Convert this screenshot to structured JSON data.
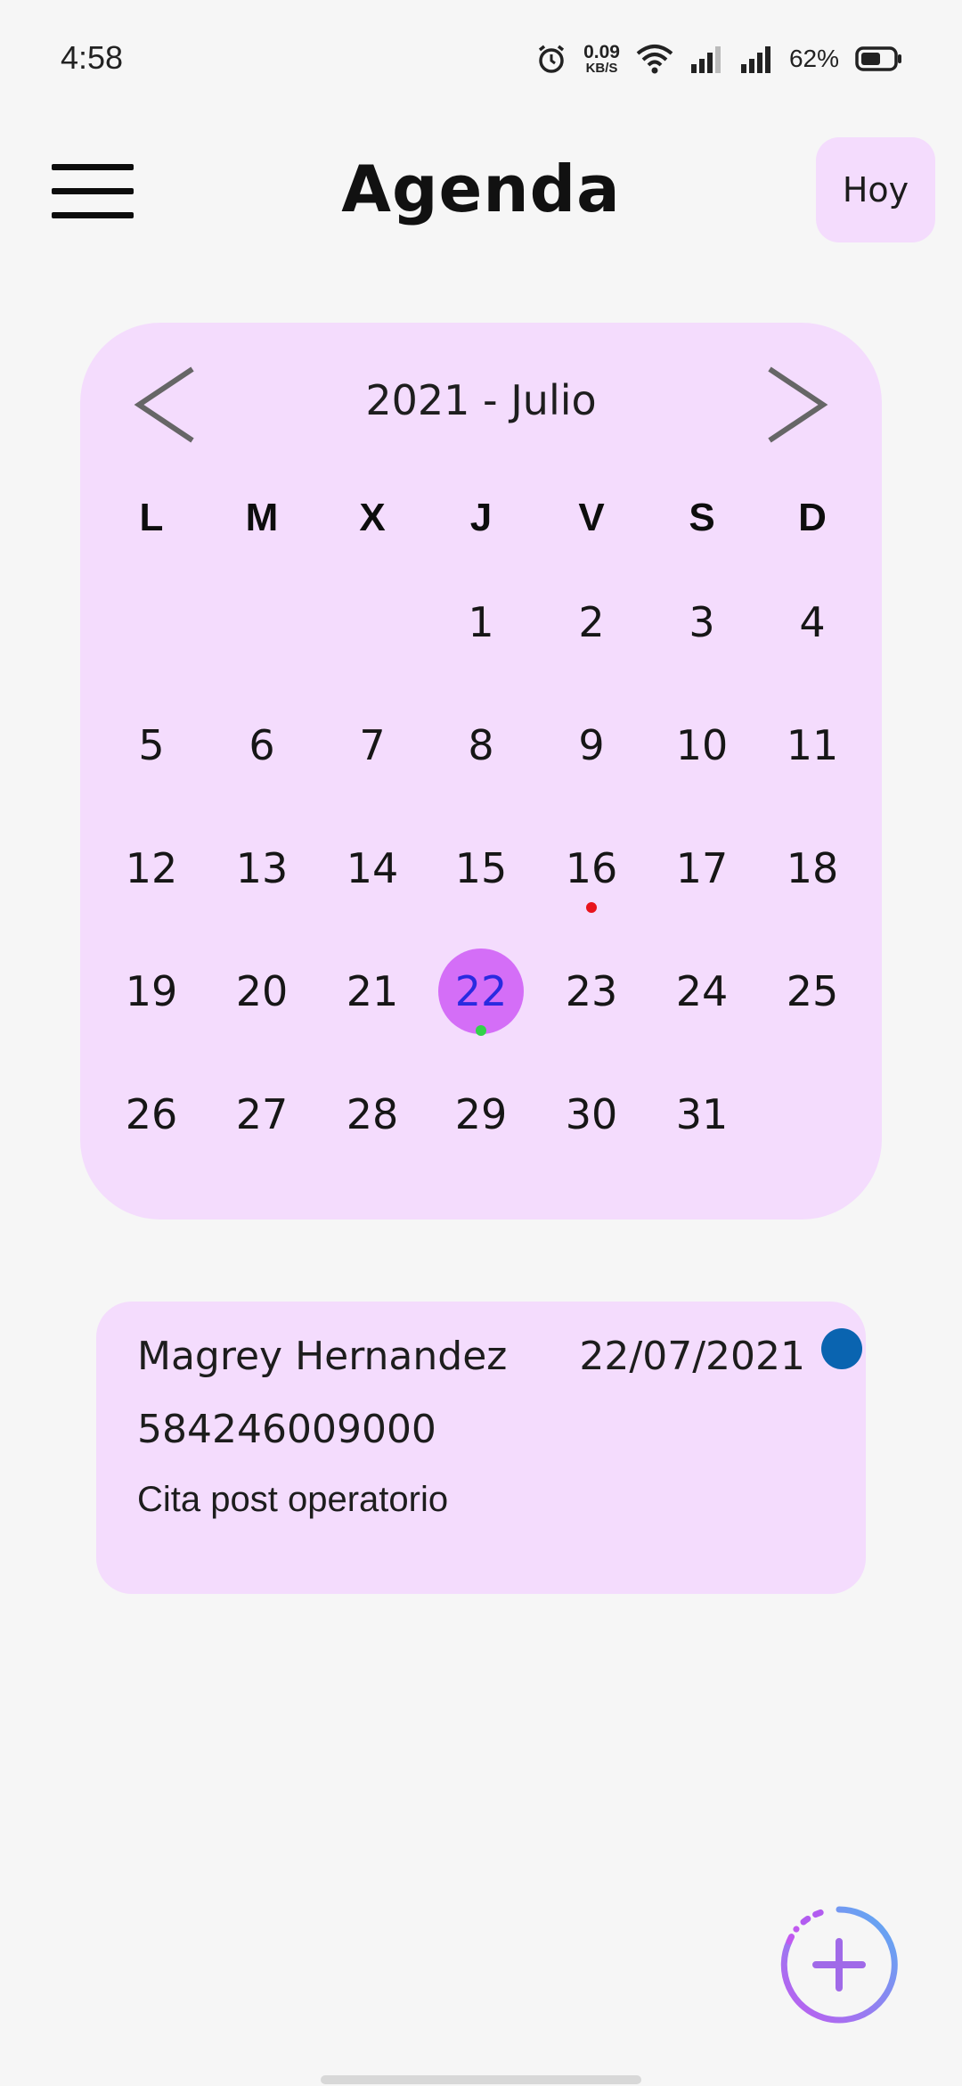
{
  "status_bar": {
    "time": "4:58",
    "net_speed_value": "0.09",
    "net_speed_unit": "KB/S",
    "battery_percent": "62%",
    "icons": [
      "alarm-icon",
      "wifi-icon",
      "signal-icon",
      "signal-icon",
      "battery-icon"
    ]
  },
  "app_bar": {
    "title": "Agenda",
    "today_label": "Hoy",
    "menu_icon": "hamburger-menu-icon"
  },
  "calendar": {
    "month_label": "2021 - Julio",
    "prev_icon": "chevron-left-icon",
    "next_icon": "chevron-right-icon",
    "weekdays": [
      "L",
      "M",
      "X",
      "J",
      "V",
      "S",
      "D"
    ],
    "first_weekday_index": 3,
    "days_in_month": 31,
    "selected_day": 22,
    "days": [
      "1",
      "2",
      "3",
      "4",
      "5",
      "6",
      "7",
      "8",
      "9",
      "10",
      "11",
      "12",
      "13",
      "14",
      "15",
      "16",
      "17",
      "18",
      "19",
      "20",
      "21",
      "22",
      "23",
      "24",
      "25",
      "26",
      "27",
      "28",
      "29",
      "30",
      "31"
    ],
    "event_markers": [
      {
        "day": 16,
        "color": "#e8141c"
      },
      {
        "day": 22,
        "color": "#32d24a"
      }
    ],
    "selected_color": "#d46ef7"
  },
  "appointment": {
    "name": "Magrey Hernandez",
    "date": "22/07/2021",
    "phone": "584246009000",
    "note": "Cita post operatorio",
    "status_color": "#0a64b0"
  },
  "fab": {
    "icon": "add-icon"
  },
  "colors": {
    "card_bg": "#f4dcfd",
    "background": "#f6f6f6",
    "accent": "#d46ef7"
  }
}
